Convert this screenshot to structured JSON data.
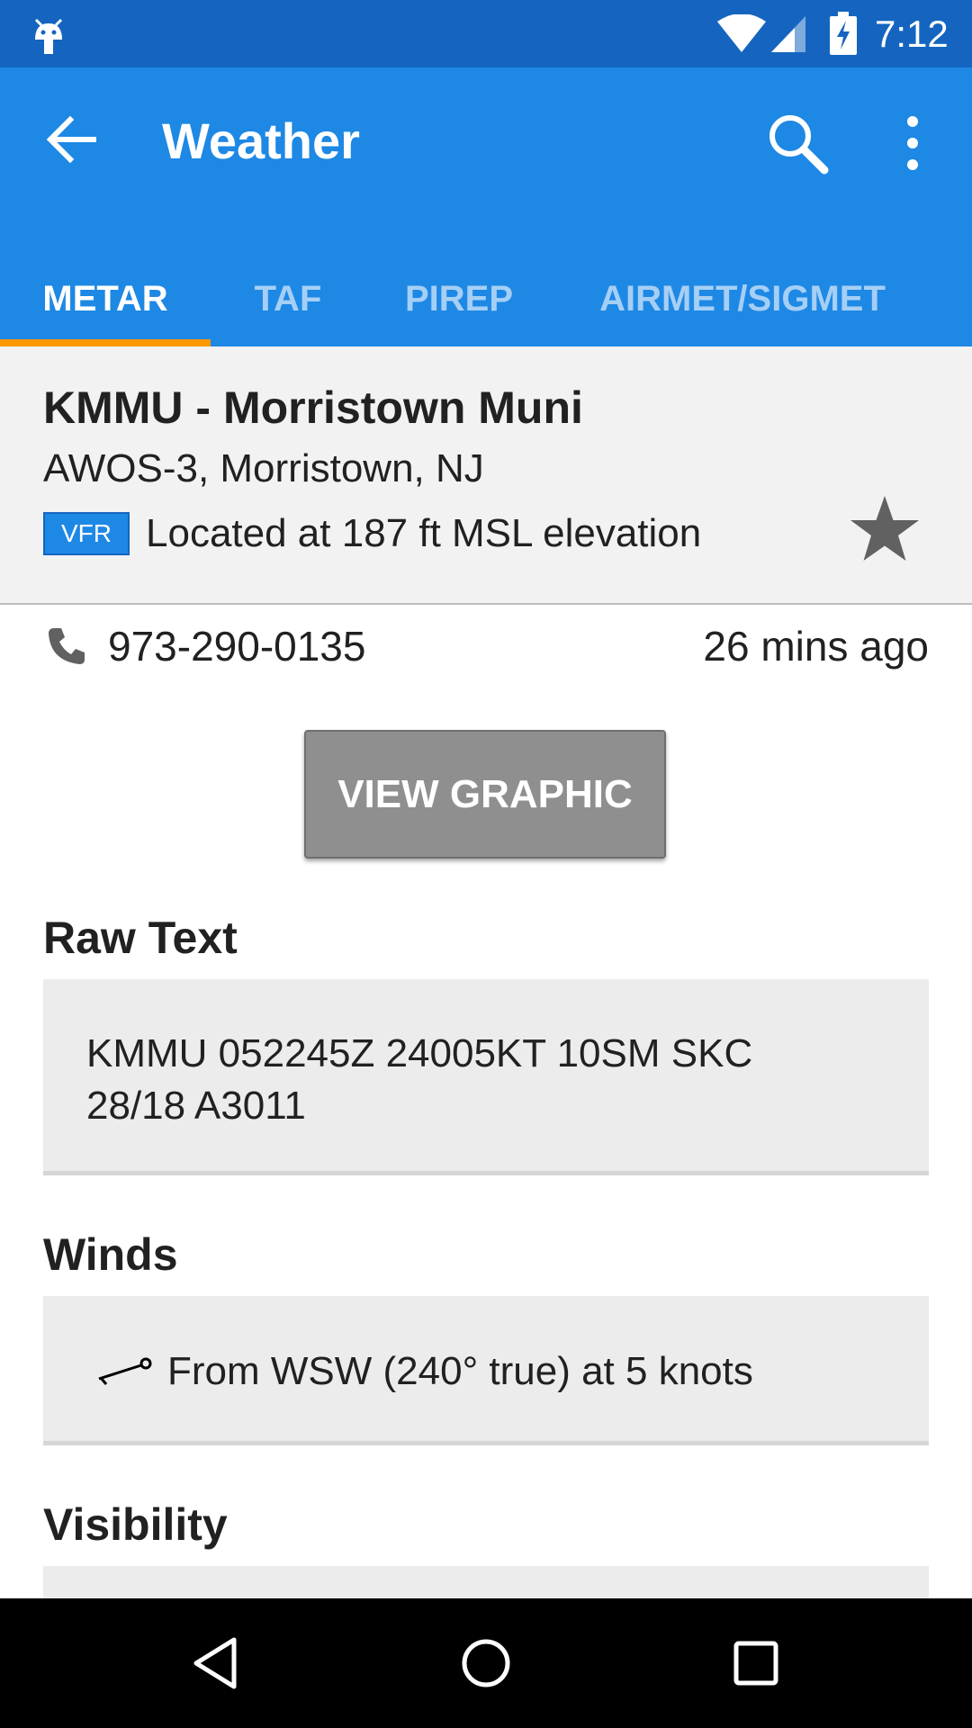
{
  "status_bar": {
    "time": "7:12",
    "icons": [
      "android-debug-icon",
      "wifi-icon",
      "cell-signal-icon",
      "battery-charging-icon"
    ]
  },
  "app_bar": {
    "title": "Weather",
    "icons": [
      "back-arrow-icon",
      "search-icon",
      "more-vert-icon"
    ],
    "tabs": [
      {
        "label": "METAR",
        "active": true
      },
      {
        "label": "TAF",
        "active": false
      },
      {
        "label": "PIREP",
        "active": false
      },
      {
        "label": "AIRMET/SIGMET",
        "active": false
      }
    ]
  },
  "airport": {
    "name": "KMMU - Morristown Muni",
    "subtitle": "AWOS-3, Morristown, NJ",
    "flight_category": "VFR",
    "elevation_text": "Located at 187 ft MSL elevation",
    "favorite_icon": "star-icon"
  },
  "contact": {
    "phone": "973-290-0135",
    "updated": "26 mins ago"
  },
  "view_graphic_label": "VIEW GRAPHIC",
  "sections": {
    "raw_text": {
      "title": "Raw Text",
      "line1": "KMMU 052245Z 24005KT 10SM SKC",
      "line2": "28/18 A3011"
    },
    "winds": {
      "title": "Winds",
      "text": "From WSW (240° true) at 5 knots",
      "direction_degrees": 240
    },
    "visibility": {
      "title": "Visibility"
    }
  },
  "colors": {
    "status_bar": "#1565c0",
    "app_bar": "#1e88e5",
    "tab_indicator": "#ff9800",
    "vfr_badge": "#1e88e5",
    "button": "#8f8f8f"
  }
}
